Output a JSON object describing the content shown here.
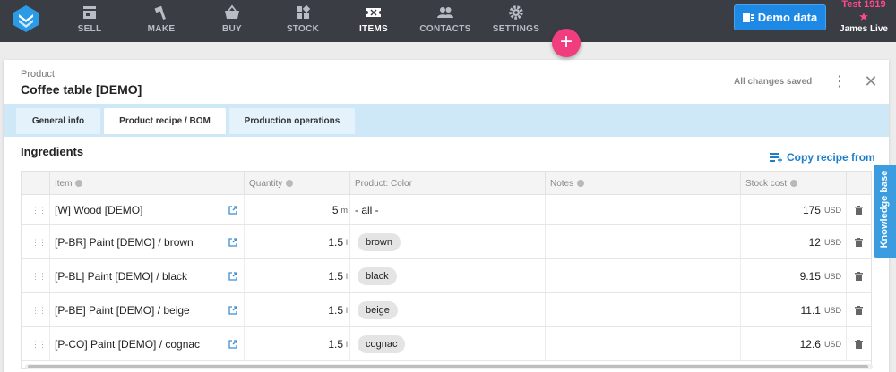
{
  "nav": {
    "items": [
      {
        "label": "SELL",
        "icon": "store-icon"
      },
      {
        "label": "MAKE",
        "icon": "hammer-icon"
      },
      {
        "label": "BUY",
        "icon": "basket-icon"
      },
      {
        "label": "STOCK",
        "icon": "stock-boxes-icon"
      },
      {
        "label": "ITEMS",
        "icon": "items-ticket-icon",
        "active": true
      },
      {
        "label": "CONTACTS",
        "icon": "people-icon"
      },
      {
        "label": "SETTINGS",
        "icon": "gear-icon"
      }
    ],
    "demo_button": "Demo data",
    "company": "Test 1919",
    "user": "James Live"
  },
  "panel": {
    "kind": "Product",
    "title": "Coffee table [DEMO]",
    "status": "All changes saved"
  },
  "tabs": [
    {
      "label": "General info"
    },
    {
      "label": "Product recipe / BOM",
      "active": true
    },
    {
      "label": "Production operations"
    }
  ],
  "ingredients": {
    "title": "Ingredients",
    "copy_link": "Copy recipe from",
    "columns": {
      "item": "Item",
      "quantity": "Quantity",
      "color": "Product: Color",
      "notes": "Notes",
      "cost": "Stock cost"
    },
    "rows": [
      {
        "item": "[W] Wood [DEMO]",
        "qty": "5",
        "unit": "m",
        "color": "- all -",
        "color_chip": false,
        "cost": "175",
        "currency": "USD"
      },
      {
        "item": "[P-BR] Paint [DEMO] / brown",
        "qty": "1.5",
        "unit": "l",
        "color": "brown",
        "color_chip": true,
        "cost": "12",
        "currency": "USD"
      },
      {
        "item": "[P-BL] Paint [DEMO] / black",
        "qty": "1.5",
        "unit": "l",
        "color": "black",
        "color_chip": true,
        "cost": "9.15",
        "currency": "USD"
      },
      {
        "item": "[P-BE] Paint [DEMO] / beige",
        "qty": "1.5",
        "unit": "l",
        "color": "beige",
        "color_chip": true,
        "cost": "11.1",
        "currency": "USD"
      },
      {
        "item": "[P-CO] Paint [DEMO] / cognac",
        "qty": "1.5",
        "unit": "l",
        "color": "cognac",
        "color_chip": true,
        "cost": "12.6",
        "currency": "USD"
      }
    ]
  },
  "knowledge_tab": "Knowledge base",
  "colors": {
    "accent": "#1e88e5",
    "fab": "#f03d7d",
    "topbar": "#3a3d44",
    "tabbar": "#cfe8f7"
  }
}
